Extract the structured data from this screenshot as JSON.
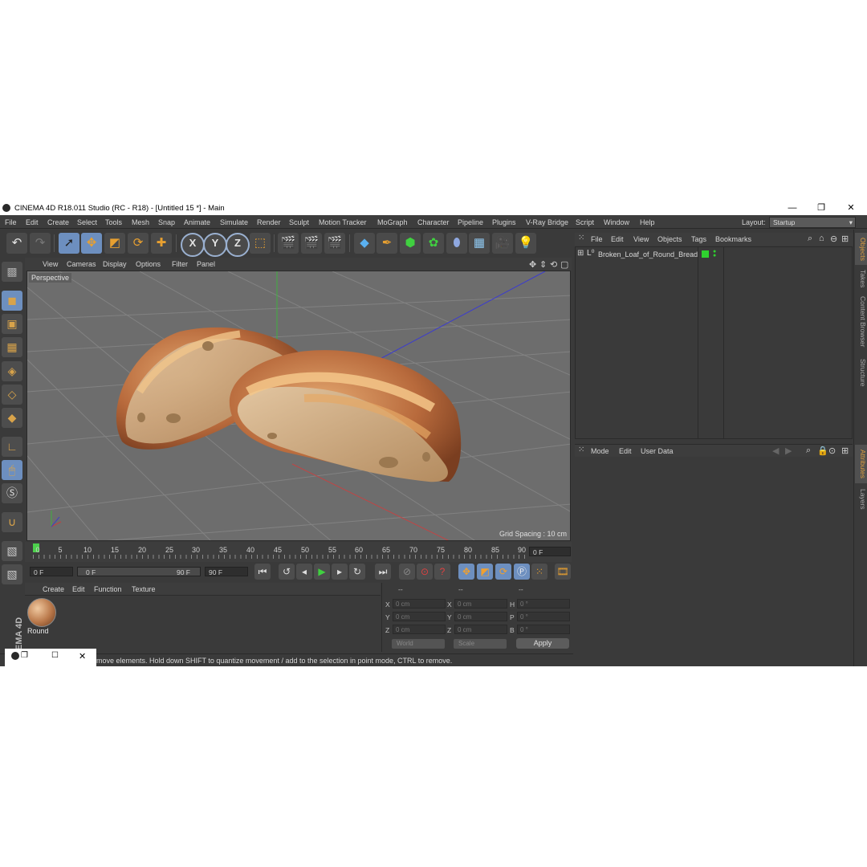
{
  "titlebar": {
    "title": "CINEMA 4D R18.011 Studio (RC - R18) - [Untitled 15 *] - Main",
    "minimize": "—",
    "maximize": "❐",
    "close": "✕"
  },
  "menubar": {
    "items": [
      "File",
      "Edit",
      "Create",
      "Select",
      "Tools",
      "Mesh",
      "Snap",
      "Animate",
      "Simulate",
      "Render",
      "Sculpt",
      "Motion Tracker",
      "MoGraph",
      "Character",
      "Pipeline",
      "Plugins",
      "V-Ray Bridge",
      "Script",
      "Window",
      "Help"
    ],
    "layout_label": "Layout:",
    "layout_value": "Startup"
  },
  "toolbar": {
    "x_label": "X",
    "y_label": "Y",
    "z_label": "Z"
  },
  "viewport": {
    "menu": [
      "View",
      "Cameras",
      "Display",
      "Options",
      "Filter",
      "Panel"
    ],
    "label": "Perspective",
    "grid_spacing": "Grid Spacing : 10 cm"
  },
  "timeline": {
    "ticks": [
      "0",
      "5",
      "10",
      "15",
      "20",
      "25",
      "30",
      "35",
      "40",
      "45",
      "50",
      "55",
      "60",
      "65",
      "70",
      "75",
      "80",
      "85",
      "90"
    ],
    "end_field": "0 F",
    "current_frame": "0 F",
    "range_start": "0 F",
    "range_end": "90 F",
    "max_frame": "90 F"
  },
  "material": {
    "menu": [
      "Create",
      "Edit",
      "Function",
      "Texture"
    ],
    "name": "Round"
  },
  "coordinates": {
    "header": [
      "--",
      "--",
      "--"
    ],
    "rows": [
      {
        "a": "X",
        "av": "0 cm",
        "b": "X",
        "bv": "0 cm",
        "c": "H",
        "cv": "0 °"
      },
      {
        "a": "Y",
        "av": "0 cm",
        "b": "Y",
        "bv": "0 cm",
        "c": "P",
        "cv": "0 °"
      },
      {
        "a": "Z",
        "av": "0 cm",
        "b": "Z",
        "bv": "0 cm",
        "c": "B",
        "cv": "0 °"
      }
    ],
    "world": "World",
    "scale": "Scale",
    "apply": "Apply"
  },
  "status": {
    "text": "move elements. Hold down SHIFT to quantize movement / add to the selection in point mode, CTRL to remove."
  },
  "objects": {
    "menu": [
      "File",
      "Edit",
      "View",
      "Objects",
      "Tags",
      "Bookmarks"
    ],
    "object_name": "Broken_Loaf_of_Round_Bread",
    "layer_color": "#2fd12f"
  },
  "attributes": {
    "menu": [
      "Mode",
      "Edit",
      "User Data"
    ]
  },
  "side_tabs": [
    "Objects",
    "Takes",
    "Content Browser",
    "Structure",
    "Attributes",
    "Layers"
  ],
  "brand": "MAXON CINEMA 4D",
  "colors": {
    "accent_orange": "#e0a040",
    "selected_blue": "#6d8fbf",
    "axis_x": "#c04040",
    "axis_y": "#40b040",
    "axis_z": "#4040c0"
  }
}
